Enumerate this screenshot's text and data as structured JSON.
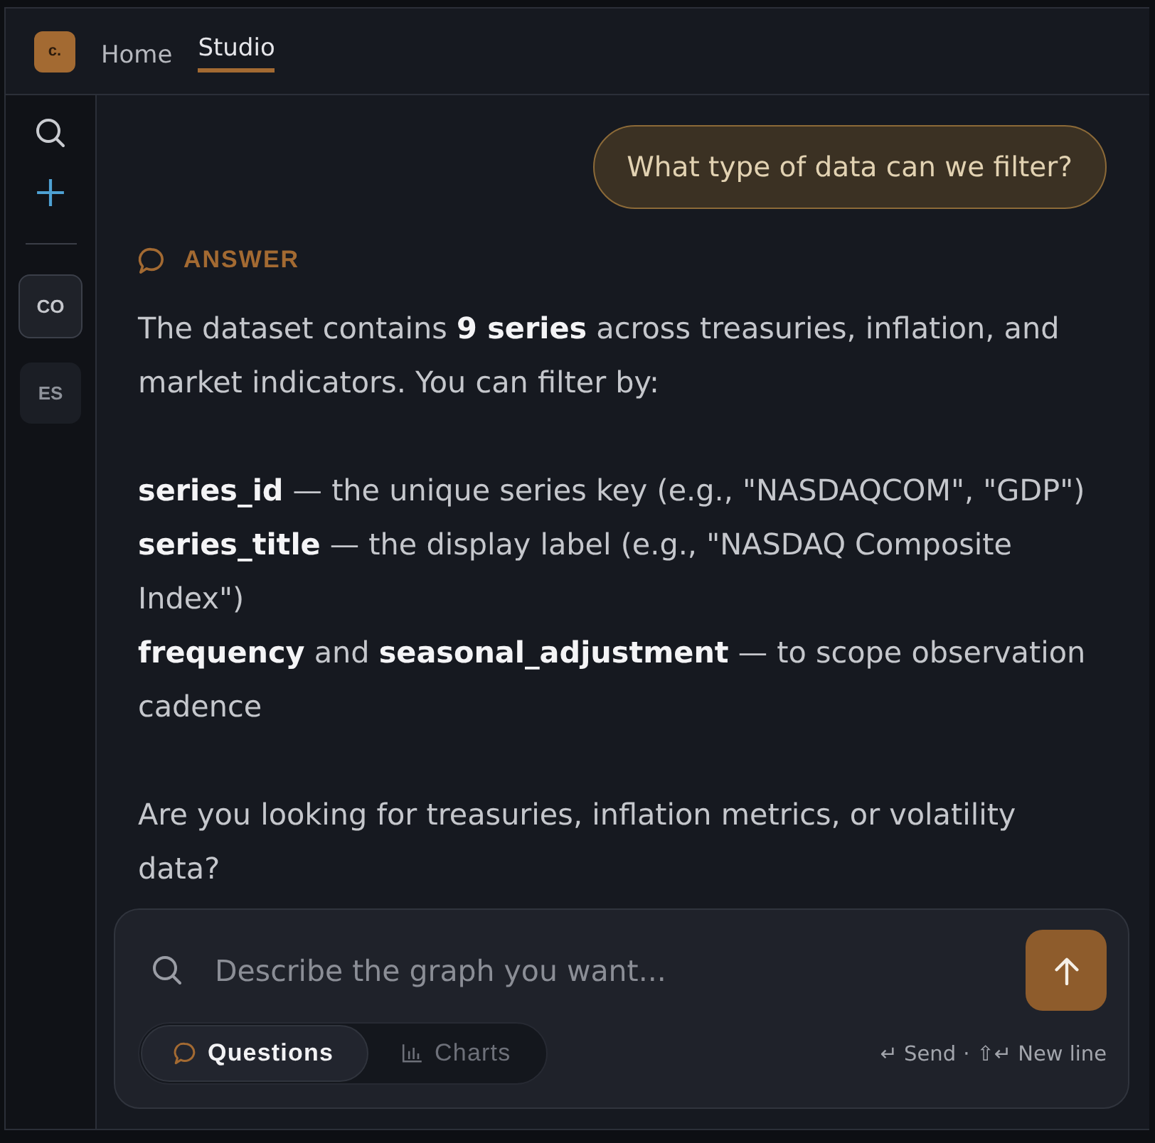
{
  "nav": {
    "logo": "c.",
    "tabs": [
      {
        "label": "Home",
        "selected": false
      },
      {
        "label": "Studio",
        "selected": true
      }
    ]
  },
  "sidebar": {
    "workspaces": [
      {
        "label": "CO",
        "selected": true
      },
      {
        "label": "ES",
        "selected": false
      }
    ]
  },
  "user_message": {
    "text": "What type of data can we filter?"
  },
  "answer": {
    "label": "ANSWER",
    "paragraphs": [
      [
        "The dataset contains **9 series** across treasuries, inflation, and market indicators. You can filter by:"
      ],
      [
        "**series_id** — the unique series key (e.g., \"NASDAQCOM\", \"GDP\")",
        "**series_title** — the display label (e.g., \"NASDAQ Composite Index\")",
        "**frequency** and **seasonal_adjustment** — to scope observation cadence"
      ],
      [
        "Are you looking for treasuries, inflation metrics, or volatility data?"
      ]
    ]
  },
  "composer": {
    "placeholder": "Describe the graph you want...",
    "modes": [
      {
        "label": "Questions",
        "kind": "chat",
        "selected": true
      },
      {
        "label": "Charts",
        "kind": "bars",
        "selected": false
      }
    ],
    "hints": [
      {
        "keys": "↵",
        "label": "Send"
      },
      {
        "keys": "⇧↵",
        "label": "New line"
      }
    ],
    "separator": "·"
  }
}
